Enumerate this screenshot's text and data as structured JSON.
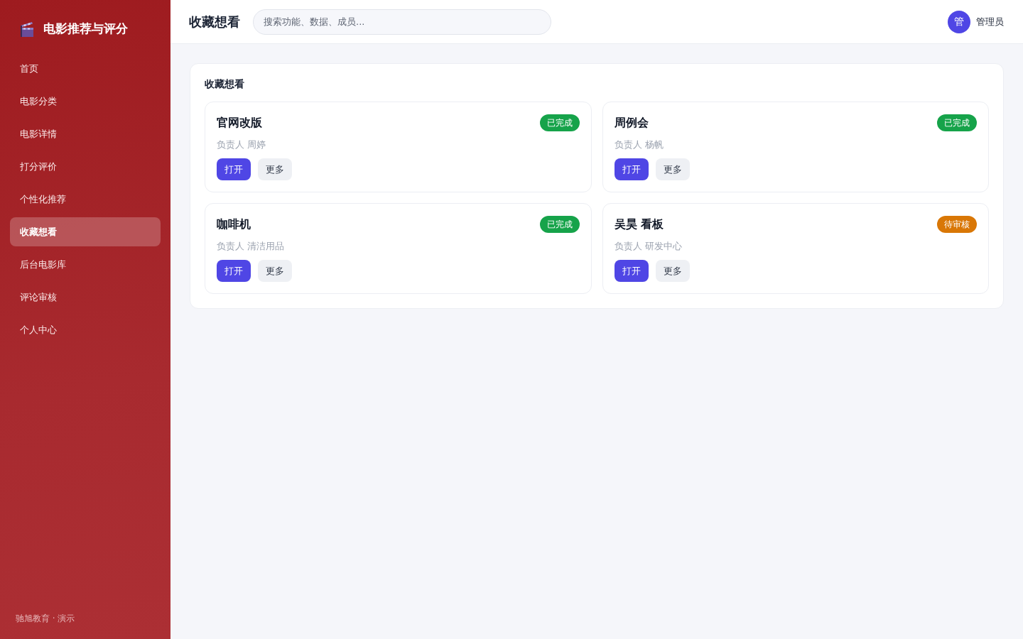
{
  "sidebar": {
    "brand": "电影推荐与评分",
    "items": [
      {
        "label": "首页",
        "selected": false
      },
      {
        "label": "电影分类",
        "selected": false
      },
      {
        "label": "电影详情",
        "selected": false
      },
      {
        "label": "打分评价",
        "selected": false
      },
      {
        "label": "个性化推荐",
        "selected": false
      },
      {
        "label": "收藏想看",
        "selected": true
      },
      {
        "label": "后台电影库",
        "selected": false
      },
      {
        "label": "评论审核",
        "selected": false
      },
      {
        "label": "个人中心",
        "selected": false
      }
    ],
    "footer": "驰旭教育 · 演示"
  },
  "header": {
    "title": "收藏想看",
    "search": {
      "placeholder": "搜索功能、数据、成员..."
    },
    "user": {
      "avatar": "管",
      "name": "管理员"
    }
  },
  "panel": {
    "title": "收藏想看",
    "cards": [
      {
        "title": "官网改版",
        "status": {
          "label": "已完成",
          "color": "#16a34a"
        },
        "owner": "负责人 周婷",
        "buttons": [
          {
            "label": "打开",
            "kind": "primary"
          },
          {
            "label": "更多",
            "kind": "secondary"
          }
        ]
      },
      {
        "title": "周例会",
        "status": {
          "label": "已完成",
          "color": "#16a34a"
        },
        "owner": "负责人 杨帆",
        "buttons": [
          {
            "label": "打开",
            "kind": "primary"
          },
          {
            "label": "更多",
            "kind": "secondary"
          }
        ]
      },
      {
        "title": "咖啡机",
        "status": {
          "label": "已完成",
          "color": "#16a34a"
        },
        "owner": "负责人 清洁用品",
        "buttons": [
          {
            "label": "打开",
            "kind": "primary"
          },
          {
            "label": "更多",
            "kind": "secondary"
          }
        ]
      },
      {
        "title": "吴昊 看板",
        "status": {
          "label": "待审核",
          "color": "#d97706"
        },
        "owner": "负责人 研发中心",
        "buttons": [
          {
            "label": "打开",
            "kind": "primary"
          },
          {
            "label": "更多",
            "kind": "secondary"
          }
        ]
      }
    ]
  }
}
